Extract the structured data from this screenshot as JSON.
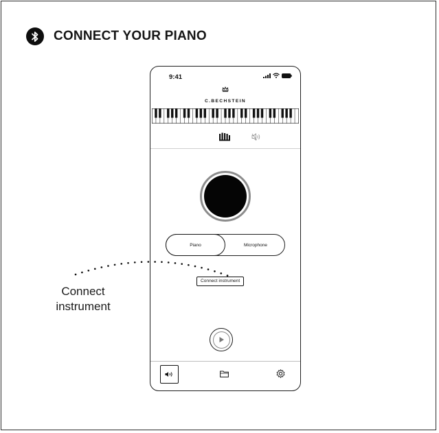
{
  "heading": {
    "title": "CONNECT YOUR PIANO",
    "icon": "bluetooth-icon"
  },
  "phone": {
    "status_time": "9:41",
    "status_icons": [
      "signal-icon",
      "wifi-icon",
      "battery-icon"
    ],
    "brand": "C.BECHSTEIN",
    "modes": [
      "hands-icon",
      "mute-icon"
    ],
    "segmented": {
      "options": [
        "Piano",
        "Microphone"
      ],
      "selected": "Piano"
    },
    "connect_button": "Connect instrument",
    "bottom_tabs": [
      "speaker-icon",
      "folder-icon",
      "gear-icon"
    ]
  },
  "callout": {
    "line1": "Connect",
    "line2": "instrument"
  },
  "colors": {
    "ink": "#111111",
    "record_ring": "#8c8c8c",
    "background": "#ffffff"
  }
}
